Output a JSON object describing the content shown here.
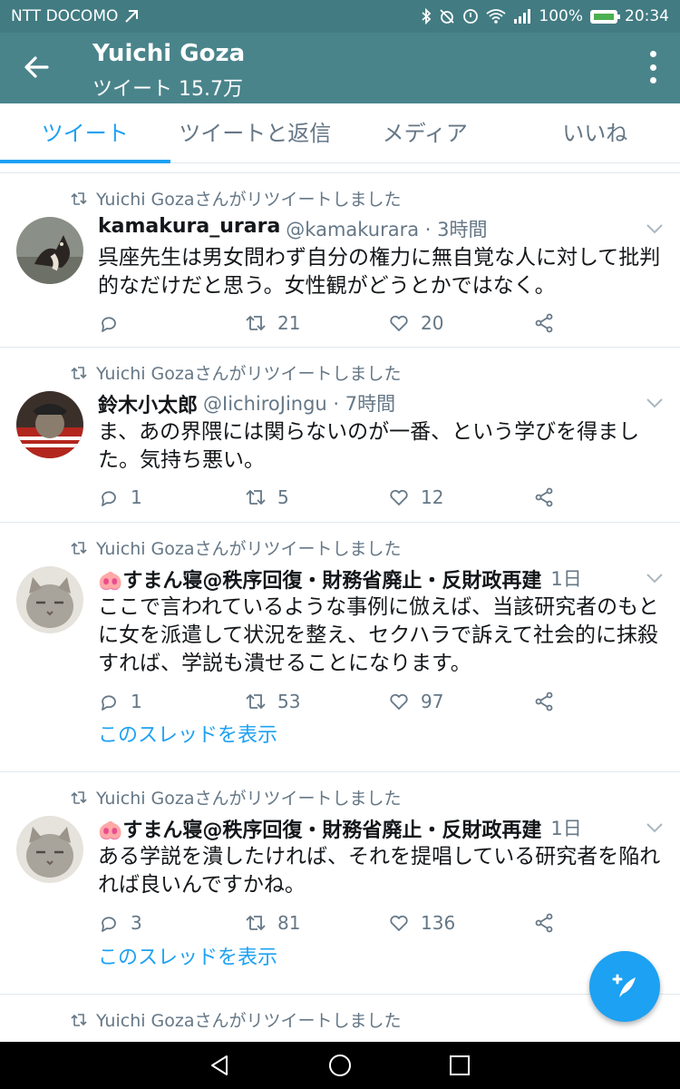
{
  "status_bar": {
    "carrier": "NTT DOCOMO",
    "battery": "100%",
    "time": "20:34"
  },
  "app_bar": {
    "title": "Yuichi Goza",
    "subtitle": "ツイート 15.7万"
  },
  "tabs": [
    {
      "label": "ツイート",
      "active": true
    },
    {
      "label": "ツイートと返信",
      "active": false
    },
    {
      "label": "メディア",
      "active": false
    },
    {
      "label": "いいね",
      "active": false
    }
  ],
  "tweets": [
    {
      "retweet_label": "Yuichi Gozaさんがリツイートしました",
      "name": "kamakura_urara",
      "handle": "@kamakurara · 3時間",
      "text": "呉座先生は男女問わず自分の権力に無自覚な人に対して批判的なだけだと思う。女性観がどうとかではなく。",
      "replies": "",
      "retweets": "21",
      "likes": "20"
    },
    {
      "retweet_label": "Yuichi Gozaさんがリツイートしました",
      "name": "鈴木小太郎",
      "handle": "@IichiroJingu · 7時間",
      "text": "ま、あの界隈には関らないのが一番、という学びを得ました。気持ち悪い。",
      "replies": "1",
      "retweets": "5",
      "likes": "12"
    },
    {
      "retweet_label": "Yuichi Gozaさんがリツイートしました",
      "name": "🐽すまん寝@秩序回復・財務省廃止・反財政再建",
      "handle": "1日",
      "text": "ここで言われているような事例に倣えば、当該研究者のもとに女を派遣して状況を整え、セクハラで訴えて社会的に抹殺すれば、学説も潰せることになります。",
      "replies": "1",
      "retweets": "53",
      "likes": "97",
      "thread_link": "このスレッドを表示"
    },
    {
      "retweet_label": "Yuichi Gozaさんがリツイートしました",
      "name": "🐽すまん寝@秩序回復・財務省廃止・反財政再建",
      "handle": "1日",
      "text": "ある学説を潰したければ、それを提唱している研究者を陥れれば良いんですかね。",
      "replies": "3",
      "retweets": "81",
      "likes": "136",
      "thread_link": "このスレッドを表示"
    },
    {
      "retweet_label": "Yuichi Gozaさんがリツイートしました"
    }
  ],
  "colors": {
    "header_teal": "#4a848b",
    "accent_blue": "#1da1f2",
    "muted_gray": "#657786"
  }
}
